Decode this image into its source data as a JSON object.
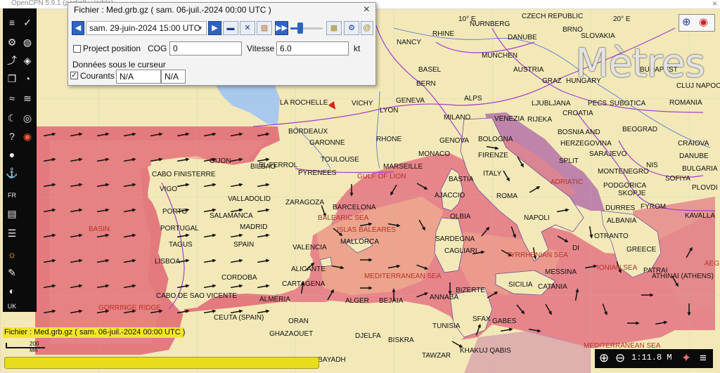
{
  "app": {
    "title": "OpenCPN 5.9.1 (partially visible)",
    "close_glyph": "×"
  },
  "grib_dialog": {
    "title": "Fichier : Med.grb.gz ( sam. 06-juil.-2024 00:00  UTC )",
    "close_glyph": "×",
    "date_value": "sam. 29-juin-2024 15:00  UTC",
    "timeline_position": 0.3,
    "project_position_label": "Project position",
    "project_position_checked": false,
    "cog_label": "COG",
    "cog_value": "0",
    "speed_label": "Vitesse",
    "speed_value": "6.0",
    "speed_unit": "kt",
    "cursor_data_label": "Données sous le curseur",
    "currents_label": "Courants",
    "currents_checked": true,
    "currents_value_1": "N/A",
    "currents_value_2": "N/A"
  },
  "status": {
    "file_info": "Fichier : Med.grb.gz ( sam. 06-juil.-2024 00:00  UTC )",
    "scale_label": "200 Mn",
    "zoom": "1:11.8 M"
  },
  "map": {
    "units_watermark": "Mètres",
    "lon_labels": [
      "10° E",
      "20° E"
    ],
    "places": [
      "CZECH REPUBLIC",
      "RHINE",
      "NURNBERG",
      "BRNO",
      "SLOVAKIA",
      "NANCY",
      "DANUBE",
      "MUNCHEN",
      "BASEL",
      "AUSTRIA",
      "BUDAPEST",
      "BERN",
      "GRAZ",
      "HUNGARY",
      "CLUJ NAPOC",
      "LA ROCHELLE",
      "VICHY",
      "GENEVA",
      "LYON",
      "ALPS",
      "MILANO",
      "LJUBLJANA",
      "PECS",
      "SUBOTICA",
      "ROMANIA",
      "CROATIA",
      "VENEZIA",
      "RIJEKA",
      "BORDEAUX",
      "GARONNE",
      "RHONE",
      "BOSNIA AND",
      "HERZEGOVINA",
      "BEOGRAD",
      "CRAIOVA",
      "DANUBE",
      "GENOVA",
      "BOLOGNA",
      "SARAJEVO",
      "TOULOUSE",
      "MONACO",
      "FIRENZE",
      "SPLIT",
      "EL FERROL",
      "GIJON",
      "BILBAO",
      "MARSEILLE",
      "NIS",
      "BULGARIA",
      "PLOVDI",
      "CABO FINISTERRE",
      "PYRENEES",
      "GULF OF LION",
      "BASTIA",
      "ITALY",
      "MONTENEGRO",
      "SOFIYA",
      "VIGO",
      "VALLADOLID",
      "AJACCIO",
      "ROMA",
      "ADRIATIC",
      "PODGORICA",
      "SKOPJE",
      "ZARAGOZA",
      "BARCELONA",
      "FYROM",
      "PORTO",
      "SALAMANCA",
      "BALEARIC SEA",
      "OLBIA",
      "NAPOLI",
      "DURRES",
      "KAVALLA",
      "BASIN",
      "PORTUGAL",
      "MADRID",
      "ISLAS BALEARES",
      "ALBANIA",
      "TAGUS",
      "SPAIN",
      "VALENCIA",
      "MALLORCA",
      "SARDEGNA",
      "CAGLIARI",
      "OTRANTO",
      "GREECE",
      "LISBOA",
      "TYRRHENIAN SEA",
      "ALICANTE",
      "MEDITERRANEAN SEA",
      "MESSINA",
      "IONIAN SEA",
      "PATRAI",
      "CORDOBA",
      "CARTAGENA",
      "SICILIA",
      "CATANIA",
      "ATHINAI (ATHENS)",
      "AEGEA",
      "CABO DE SAO VICENTE",
      "ALMERIA",
      "BIZERTE",
      "ANNABA",
      "ALGER",
      "BEJAIA",
      "GORRINGE RIDGE",
      "CEUTA (SPAIN)",
      "ORAN",
      "TUNISIA",
      "SFAX",
      "GHAZAOUET",
      "DJELFA",
      "BISKRA",
      "GABES",
      "KHAKUJ QABIS",
      "MEDITERRANEAN SEA",
      "BE BAYADH",
      "TAWZAR",
      "DI"
    ]
  },
  "toolbar": {
    "icons": [
      "menu-icon",
      "grib-icon",
      "settings-icon",
      "globe-icon",
      "route-icon",
      "layers-icon",
      "stack-icon",
      "gauge-icon",
      "wave-icon",
      "current-icon",
      "weather-icon",
      "tide-icon",
      "help-icon",
      "lifering-icon",
      "record-icon",
      "anchor-icon",
      "flag-fr-icon",
      "flag-uk-icon"
    ]
  },
  "colors": {
    "accent": "#2f63c3",
    "land": "#f3e9b8",
    "sea_current_fast": "#e26a78",
    "sea_current_slow": "#eaa98f",
    "status_yellow": "#f3e62a",
    "border_purple": "#a43fc8"
  }
}
